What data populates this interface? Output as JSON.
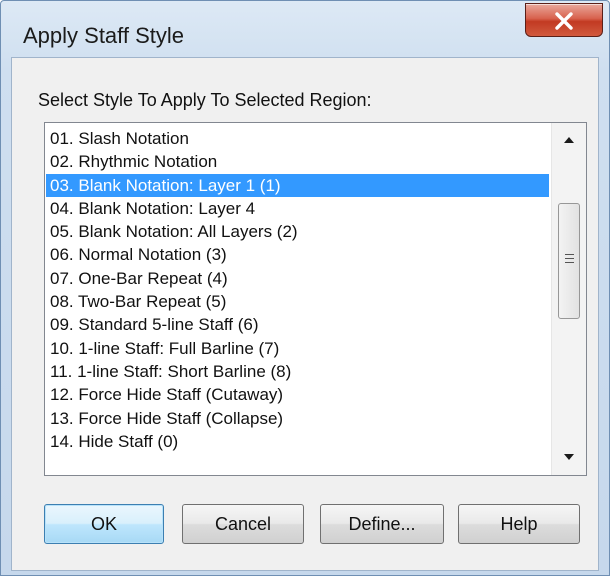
{
  "window": {
    "title": "Apply Staff Style"
  },
  "dialog": {
    "prompt": "Select Style To Apply To Selected Region:",
    "selected_index": 2,
    "styles": [
      "01.  Slash Notation",
      "02.  Rhythmic Notation",
      "03.  Blank Notation:  Layer 1 (1)",
      "04.  Blank Notation:  Layer 4",
      "05.  Blank Notation:  All Layers (2)",
      "06.  Normal Notation (3)",
      "07.  One-Bar Repeat (4)",
      "08.  Two-Bar Repeat (5)",
      "09.  Standard 5-line Staff (6)",
      "10.  1-line Staff:  Full Barline (7)",
      "11.  1-line Staff:  Short Barline (8)",
      "12.  Force Hide Staff (Cutaway)",
      "13. Force Hide Staff (Collapse)",
      "14.  Hide Staff (0)"
    ]
  },
  "buttons": {
    "ok": "OK",
    "cancel": "Cancel",
    "define": "Define...",
    "help": "Help"
  },
  "icons": {
    "close": "close-icon",
    "scroll_up": "chevron-up-icon",
    "scroll_down": "chevron-down-icon"
  },
  "colors": {
    "selection": "#3399ff",
    "close_button": "#c23a22",
    "default_button_border": "#3c7fb1"
  }
}
